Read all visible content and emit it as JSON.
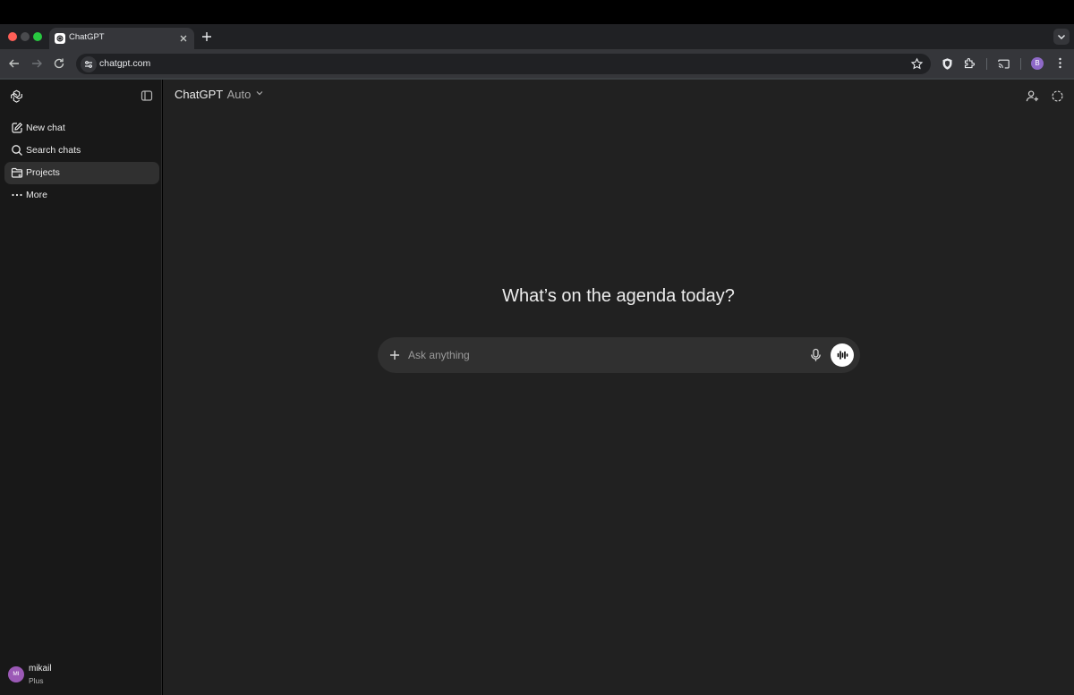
{
  "browser": {
    "tab": {
      "title": "ChatGPT"
    },
    "address_bar": {
      "url": "chatgpt.com"
    },
    "profile_initial": "B"
  },
  "sidebar": {
    "items": [
      {
        "label": "New chat",
        "icon": "new-chat-icon"
      },
      {
        "label": "Search chats",
        "icon": "search-icon"
      },
      {
        "label": "Projects",
        "icon": "folder-icon",
        "active": true
      },
      {
        "label": "More",
        "icon": "more-icon"
      }
    ],
    "user": {
      "initials": "MI",
      "name": "mikail",
      "plan": "Plus"
    }
  },
  "header": {
    "model_name": "ChatGPT",
    "model_mode": "Auto"
  },
  "main": {
    "headline": "What’s on the agenda today?",
    "composer": {
      "placeholder": "Ask anything"
    }
  },
  "colors": {
    "sidebar_bg": "#181818",
    "main_bg": "#212121",
    "composer_bg": "#303030",
    "active_item_bg": "#303030",
    "avatar": "#9b59b6",
    "profile": "#8e69c7"
  }
}
